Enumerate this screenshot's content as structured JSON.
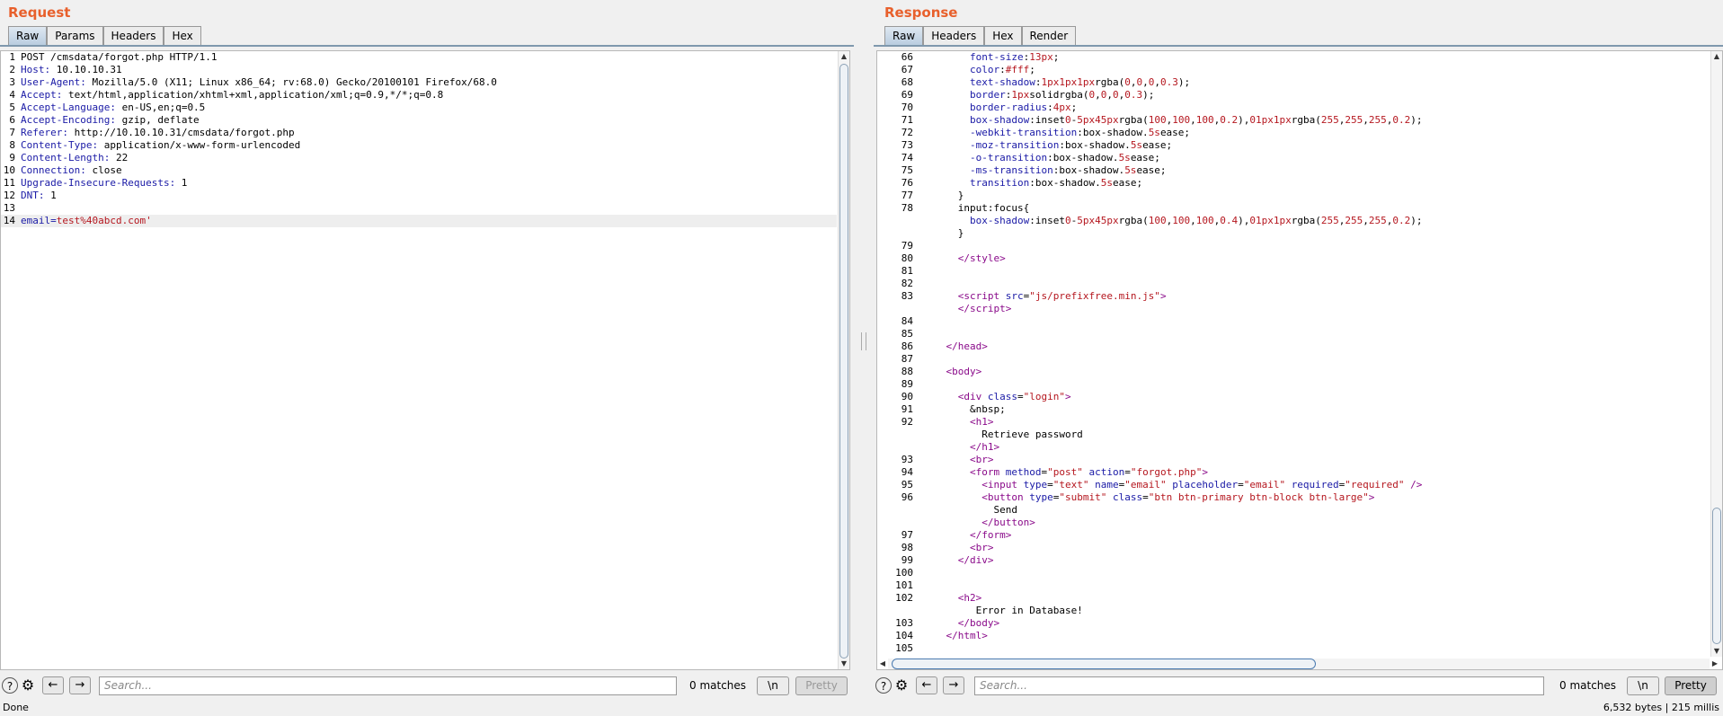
{
  "request": {
    "title": "Request",
    "tabs": [
      "Raw",
      "Params",
      "Headers",
      "Hex"
    ],
    "lines": [
      {
        "n": "1",
        "key": "",
        "val": "POST /cmsdata/forgot.php HTTP/1.1"
      },
      {
        "n": "2",
        "key": "Host:",
        "val": " 10.10.10.31"
      },
      {
        "n": "3",
        "key": "User-Agent:",
        "val": " Mozilla/5.0 (X11; Linux x86_64; rv:68.0) Gecko/20100101 Firefox/68.0"
      },
      {
        "n": "4",
        "key": "Accept:",
        "val": " text/html,application/xhtml+xml,application/xml;q=0.9,*/*;q=0.8"
      },
      {
        "n": "5",
        "key": "Accept-Language:",
        "val": " en-US,en;q=0.5"
      },
      {
        "n": "6",
        "key": "Accept-Encoding:",
        "val": " gzip, deflate"
      },
      {
        "n": "7",
        "key": "Referer:",
        "val": " http://10.10.10.31/cmsdata/forgot.php"
      },
      {
        "n": "8",
        "key": "Content-Type:",
        "val": " application/x-www-form-urlencoded"
      },
      {
        "n": "9",
        "key": "Content-Length:",
        "val": " 22"
      },
      {
        "n": "10",
        "key": "Connection:",
        "val": " close"
      },
      {
        "n": "11",
        "key": "Upgrade-Insecure-Requests:",
        "val": " 1"
      },
      {
        "n": "12",
        "key": "DNT:",
        "val": " 1"
      },
      {
        "n": "13",
        "key": "",
        "val": ""
      },
      {
        "n": "14",
        "key": "email=",
        "val": "test%40abcd.com'"
      }
    ],
    "search_placeholder": "Search...",
    "matches": "0 matches",
    "newline_label": "\\n",
    "pretty_label": "Pretty"
  },
  "response": {
    "title": "Response",
    "tabs": [
      "Raw",
      "Headers",
      "Hex",
      "Render"
    ],
    "lines": [
      {
        "n": "66",
        "html": "        <span class='blue'>font-size</span>:<span class='red'>13px</span>;"
      },
      {
        "n": "67",
        "html": "        <span class='blue'>color</span>:<span class='red'>#fff</span>;"
      },
      {
        "n": "68",
        "html": "        <span class='blue'>text-shadow</span>:<span class='red'>1px</span><span class='red'>1px</span><span class='red'>1px</span>rgba(<span class='red'>0</span>,<span class='red'>0</span>,<span class='red'>0</span>,<span class='red'>0.3</span>);"
      },
      {
        "n": "69",
        "html": "        <span class='blue'>border</span>:<span class='red'>1px</span>solidrgba(<span class='red'>0</span>,<span class='red'>0</span>,<span class='red'>0</span>,<span class='red'>0.3</span>);"
      },
      {
        "n": "70",
        "html": "        <span class='blue'>border-radius</span>:<span class='red'>4px</span>;"
      },
      {
        "n": "71",
        "html": "        <span class='blue'>box-shadow</span>:inset<span class='red'>0</span>-<span class='red'>5px</span><span class='red'>45px</span>rgba(<span class='red'>100</span>,<span class='red'>100</span>,<span class='red'>100</span>,<span class='red'>0.2</span>),<span class='red'>0</span><span class='red'>1px</span><span class='red'>1px</span>rgba(<span class='red'>255</span>,<span class='red'>255</span>,<span class='red'>255</span>,<span class='red'>0.2</span>);"
      },
      {
        "n": "72",
        "html": "        <span class='blue'>-webkit-transition</span>:box-shadow.<span class='red'>5s</span>ease;"
      },
      {
        "n": "73",
        "html": "        <span class='blue'>-moz-transition</span>:box-shadow.<span class='red'>5s</span>ease;"
      },
      {
        "n": "74",
        "html": "        <span class='blue'>-o-transition</span>:box-shadow.<span class='red'>5s</span>ease;"
      },
      {
        "n": "75",
        "html": "        <span class='blue'>-ms-transition</span>:box-shadow.<span class='red'>5s</span>ease;"
      },
      {
        "n": "76",
        "html": "        <span class='blue'>transition</span>:box-shadow.<span class='red'>5s</span>ease;"
      },
      {
        "n": "77",
        "html": "      }"
      },
      {
        "n": "78",
        "html": "      input:focus{"
      },
      {
        "n": "",
        "html": "        <span class='blue'>box-shadow</span>:inset<span class='red'>0</span>-<span class='red'>5px</span><span class='red'>45px</span>rgba(<span class='red'>100</span>,<span class='red'>100</span>,<span class='red'>100</span>,<span class='red'>0.4</span>),<span class='red'>0</span><span class='red'>1px</span><span class='red'>1px</span>rgba(<span class='red'>255</span>,<span class='red'>255</span>,<span class='red'>255</span>,<span class='red'>0.2</span>);"
      },
      {
        "n": "",
        "html": "      }"
      },
      {
        "n": "79",
        "html": ""
      },
      {
        "n": "80",
        "html": "      <span class='tag'>&lt;/style&gt;</span>"
      },
      {
        "n": "81",
        "html": ""
      },
      {
        "n": "82",
        "html": ""
      },
      {
        "n": "83",
        "html": "      <span class='tag'>&lt;script</span> <span class='attr'>src</span>=<span class='str'>\"js/prefixfree.min.js\"</span><span class='tag'>&gt;</span>"
      },
      {
        "n": "",
        "html": "      <span class='tag'>&lt;/script&gt;</span>"
      },
      {
        "n": "84",
        "html": ""
      },
      {
        "n": "85",
        "html": ""
      },
      {
        "n": "86",
        "html": "    <span class='tag'>&lt;/head&gt;</span>"
      },
      {
        "n": "87",
        "html": ""
      },
      {
        "n": "88",
        "html": "    <span class='tag'>&lt;body&gt;</span>"
      },
      {
        "n": "89",
        "html": ""
      },
      {
        "n": "90",
        "html": "      <span class='tag'>&lt;div</span> <span class='attr'>class</span>=<span class='str'>\"login\"</span><span class='tag'>&gt;</span>"
      },
      {
        "n": "91",
        "html": "        &amp;nbsp;"
      },
      {
        "n": "92",
        "html": "        <span class='tag'>&lt;h1&gt;</span>"
      },
      {
        "n": "",
        "html": "          Retrieve password"
      },
      {
        "n": "",
        "html": "        <span class='tag'>&lt;/h1&gt;</span>"
      },
      {
        "n": "93",
        "html": "        <span class='tag'>&lt;br&gt;</span>"
      },
      {
        "n": "94",
        "html": "        <span class='tag'>&lt;form</span> <span class='attr'>method</span>=<span class='str'>\"post\"</span> <span class='attr'>action</span>=<span class='str'>\"forgot.php\"</span><span class='tag'>&gt;</span>"
      },
      {
        "n": "95",
        "html": "          <span class='tag'>&lt;input</span> <span class='attr'>type</span>=<span class='str'>\"text\"</span> <span class='attr'>name</span>=<span class='str'>\"email\"</span> <span class='attr'>placeholder</span>=<span class='str'>\"email\"</span> <span class='attr'>required</span>=<span class='str'>\"required\"</span> <span class='tag'>/&gt;</span>"
      },
      {
        "n": "96",
        "html": "          <span class='tag'>&lt;button</span> <span class='attr'>type</span>=<span class='str'>\"submit\"</span> <span class='attr'>class</span>=<span class='str'>\"btn btn-primary btn-block btn-large\"</span><span class='tag'>&gt;</span>"
      },
      {
        "n": "",
        "html": "            Send"
      },
      {
        "n": "",
        "html": "          <span class='tag'>&lt;/button&gt;</span>"
      },
      {
        "n": "97",
        "html": "        <span class='tag'>&lt;/form&gt;</span>"
      },
      {
        "n": "98",
        "html": "        <span class='tag'>&lt;br&gt;</span>"
      },
      {
        "n": "99",
        "html": "      <span class='tag'>&lt;/div&gt;</span>"
      },
      {
        "n": "100",
        "html": ""
      },
      {
        "n": "101",
        "html": ""
      },
      {
        "n": "102",
        "html": "      <span class='tag'>&lt;h2&gt;</span>"
      },
      {
        "n": "",
        "html": "         Error in Database!"
      },
      {
        "n": "103",
        "html": "      <span class='tag'>&lt;/body&gt;</span>"
      },
      {
        "n": "104",
        "html": "    <span class='tag'>&lt;/html&gt;</span>"
      },
      {
        "n": "105",
        "html": ""
      }
    ],
    "search_placeholder": "Search...",
    "matches": "0 matches",
    "newline_label": "\\n",
    "pretty_label": "Pretty"
  },
  "status": {
    "left": "Done",
    "right": "6,532 bytes | 215 millis"
  },
  "colors": {
    "title": "#e8602c",
    "header_key": "#1a1aa6",
    "value_red": "#b5171f",
    "tag": "#8a0a8a"
  }
}
